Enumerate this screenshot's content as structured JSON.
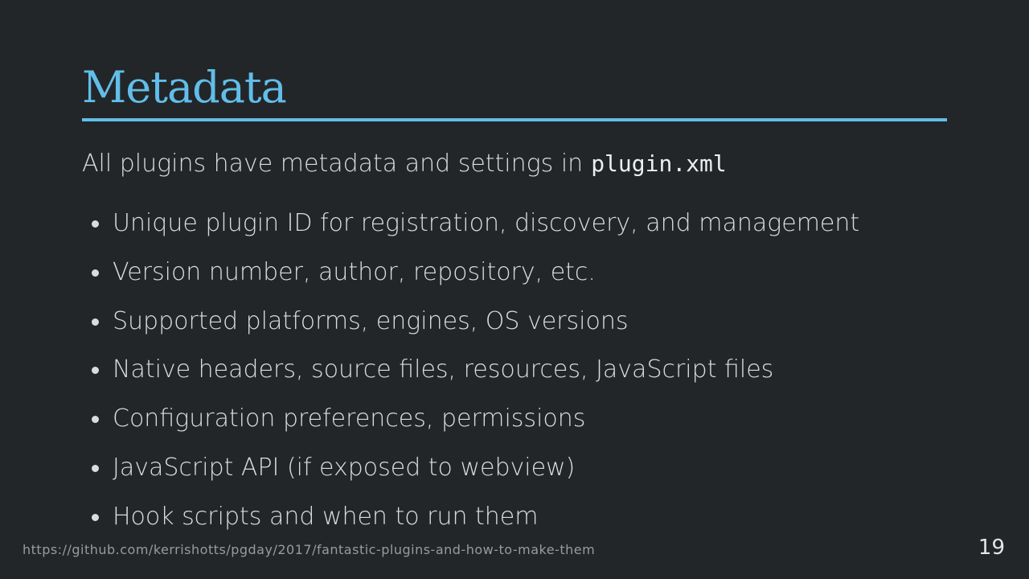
{
  "slide": {
    "title": "Metadata",
    "intro_text": "All plugins have metadata and settings in",
    "intro_code": "plugin.xml",
    "bullets": [
      "Unique plugin ID for registration, discovery, and management",
      "Version number, author, repository, etc.",
      "Supported platforms, engines, OS versions",
      "Native headers, source files, resources, JavaScript files",
      "Configuration preferences, permissions",
      "JavaScript API (if exposed to webview)",
      "Hook scripts and when to run them"
    ],
    "footer_url": "https://github.com/kerrishotts/pgday/2017/fantastic-plugins-and-how-to-make-them",
    "page_number": "19"
  },
  "colors": {
    "background": "#222628",
    "accent": "#62bde9",
    "text": "#dcdcdc"
  }
}
